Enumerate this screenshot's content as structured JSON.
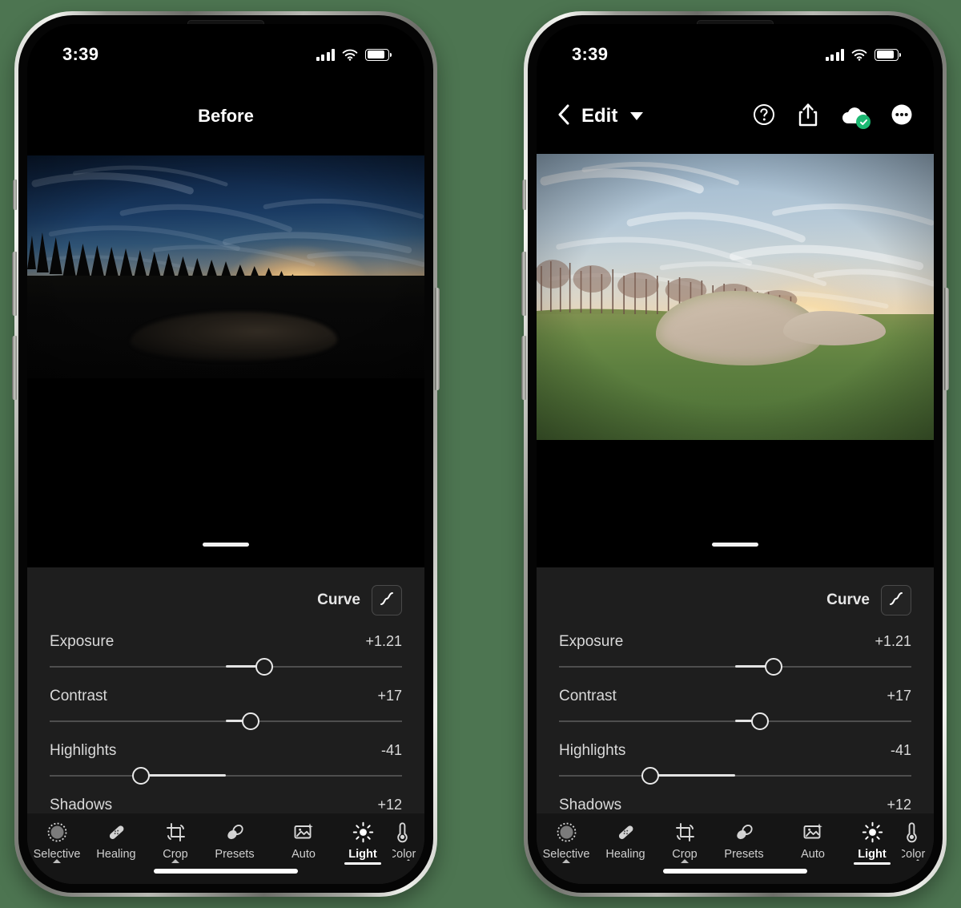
{
  "colors": {
    "page_background": "#4d7551",
    "panel_background": "#1e1e1e",
    "toolbar_background": "#151515",
    "screen_background": "#000000",
    "accent_white": "#ffffff",
    "sync_badge_green": "#1cb973",
    "slider_track": "#4e4e4e",
    "slider_fill": "#e3e3e3"
  },
  "phones": [
    {
      "id": "before",
      "status_bar": {
        "time": "3:39",
        "signal_icon": "cellular-signal-icon",
        "wifi_icon": "wifi-icon",
        "battery_icon": "battery-icon"
      },
      "navbar": {
        "layout": "centered-title",
        "title": "Before"
      },
      "photo": {
        "alt": "Golf course at sunset, underexposed original: dark silhouetted bare trees on the left, deep blue sky with wispy cirrus clouds, sun setting at the horizon, foreground in near-black shadow",
        "state": "before"
      }
    },
    {
      "id": "after",
      "status_bar": {
        "time": "3:39",
        "signal_icon": "cellular-signal-icon",
        "wifi_icon": "wifi-icon",
        "battery_icon": "battery-icon"
      },
      "navbar": {
        "layout": "edit-toolbar",
        "back_icon": "chevron-left-icon",
        "title": "Edit",
        "title_caret_icon": "caret-down-icon",
        "actions": [
          {
            "name": "help-button",
            "icon": "question-circle-icon"
          },
          {
            "name": "share-button",
            "icon": "share-upload-icon"
          },
          {
            "name": "cloud-sync-status",
            "icon": "cloud-icon",
            "badge_icon": "check-badge-icon"
          },
          {
            "name": "more-options-button",
            "icon": "ellipsis-circle-icon"
          }
        ]
      },
      "photo": {
        "alt": "Same golf course after editing: bright green fairway grass, sand bunker with water, bare trees along the left horizon, pale blue sky with warm sunset glow",
        "state": "after"
      }
    }
  ],
  "edit_panel": {
    "drag_handle": "panel-drag-handle",
    "curve": {
      "label": "Curve",
      "button_icon": "tone-curve-icon"
    },
    "sliders": [
      {
        "name": "Exposure",
        "value": "+1.21",
        "percent": 61,
        "origin": 50
      },
      {
        "name": "Contrast",
        "value": "+17",
        "percent": 57,
        "origin": 50
      },
      {
        "name": "Highlights",
        "value": "-41",
        "percent": 26,
        "origin": 50
      },
      {
        "name": "Shadows",
        "value": "+12",
        "percent": 55,
        "origin": 50
      }
    ]
  },
  "toolbar": {
    "left_group": [
      {
        "label": "Selective",
        "icon": "selective-mask-icon",
        "active": false,
        "caret": true
      },
      {
        "label": "Healing",
        "icon": "healing-bandage-icon",
        "active": false,
        "caret": false
      },
      {
        "label": "Crop",
        "icon": "crop-rotate-icon",
        "active": false,
        "caret": true
      },
      {
        "label": "Presets",
        "icon": "presets-icon",
        "active": false,
        "caret": false
      }
    ],
    "right_group": [
      {
        "label": "Auto",
        "icon": "auto-enhance-icon",
        "active": false,
        "caret": false
      },
      {
        "label": "Light",
        "icon": "light-sun-icon",
        "active": true,
        "caret": false
      },
      {
        "label": "Color",
        "icon": "color-thermometer-icon",
        "active": false,
        "caret": true
      }
    ]
  }
}
